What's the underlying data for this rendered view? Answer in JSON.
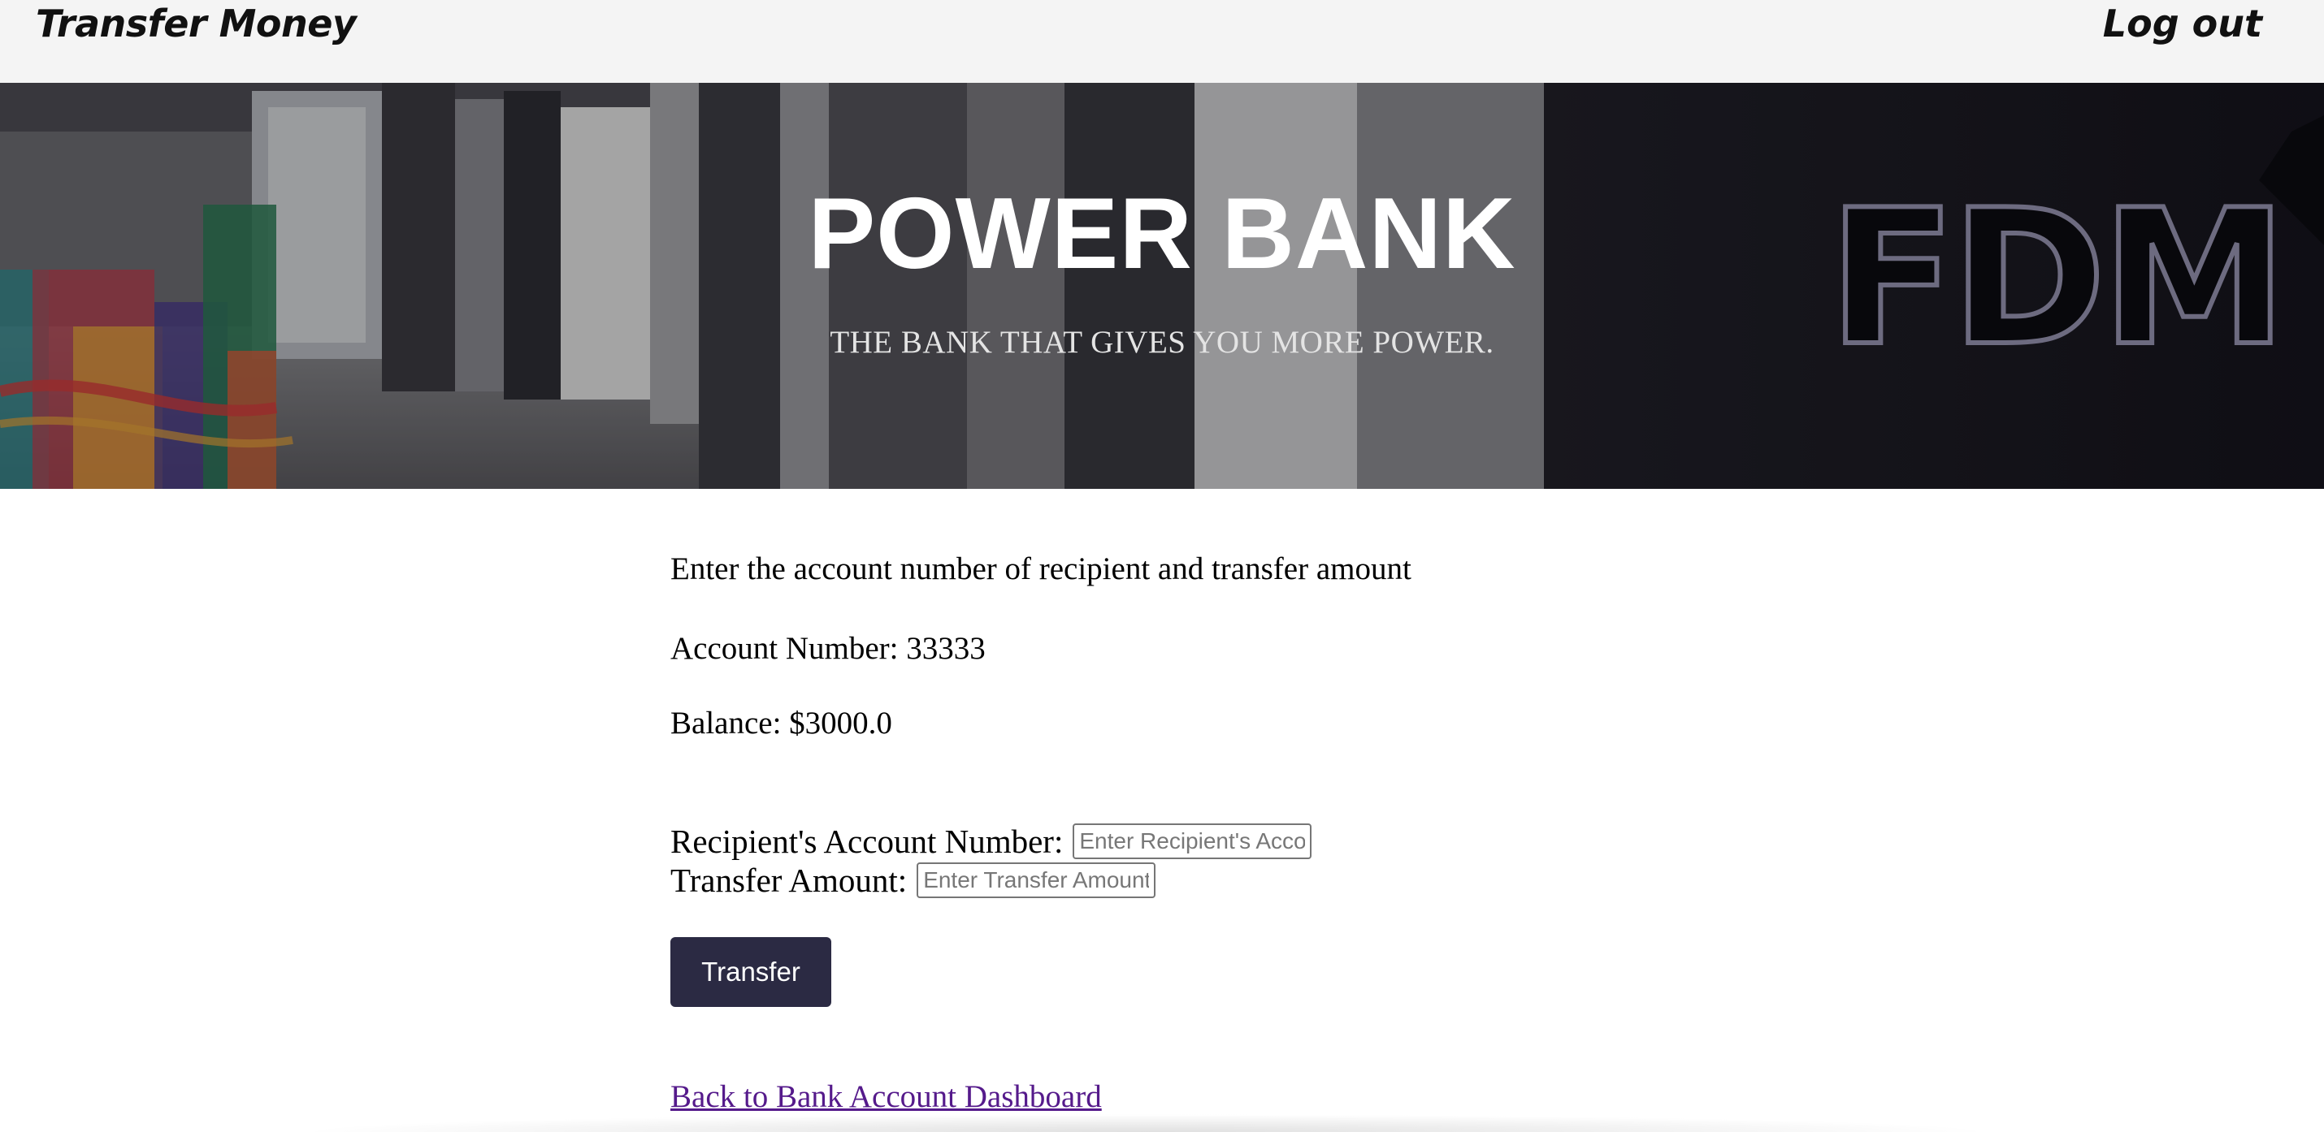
{
  "header": {
    "title": "Transfer Money",
    "logout_label": "Log out"
  },
  "hero": {
    "brand": "POWER BANK",
    "tagline": "THE BANK THAT GIVES YOU MORE POWER.",
    "signage_text": "FDM"
  },
  "main": {
    "instruction": "Enter the account number of recipient and transfer amount",
    "account_number_line": "Account Number: 33333",
    "balance_line": "Balance: $3000.0",
    "recipient_label": "Recipient's Account Number:",
    "recipient_placeholder": "Enter Recipient's Account Number",
    "amount_label": "Transfer Amount:",
    "amount_placeholder": "Enter Transfer Amount",
    "transfer_button": "Transfer",
    "back_link": "Back to Bank Account Dashboard"
  },
  "colors": {
    "header_bg": "#f4f4f4",
    "button_bg": "#2b2a43",
    "link_visited": "#551a8b"
  }
}
